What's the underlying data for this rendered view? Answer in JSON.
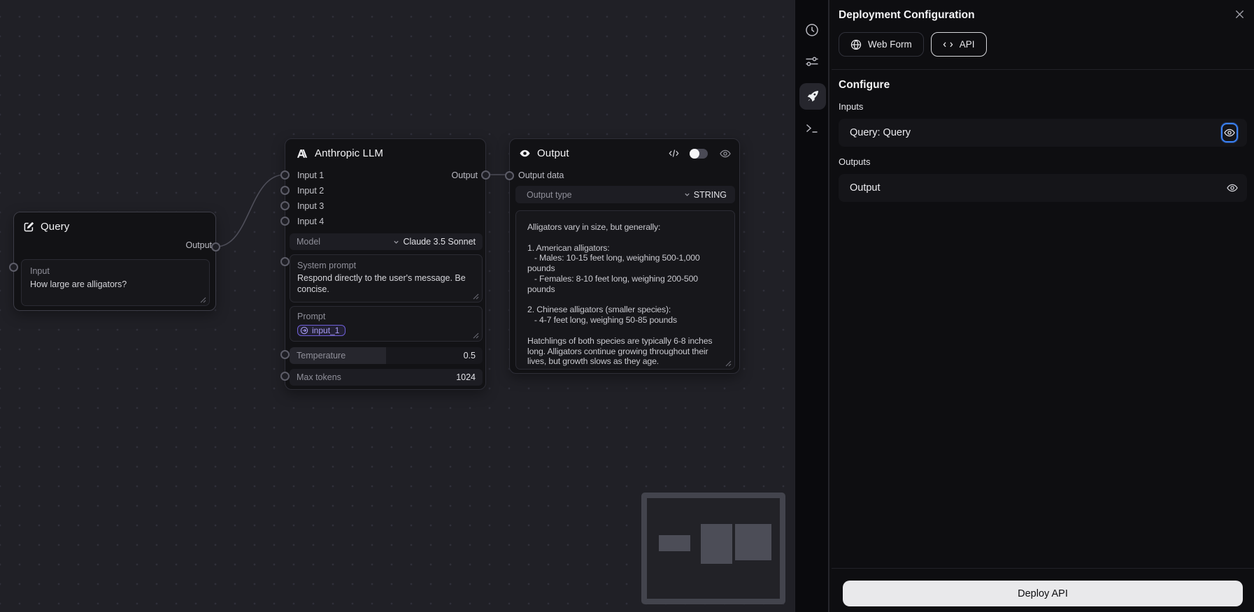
{
  "canvas": {
    "nodes": {
      "query": {
        "title": "Query",
        "output_port_label": "Output",
        "input_field": {
          "label": "Input",
          "value": "How large are alligators?"
        }
      },
      "llm": {
        "title": "Anthropic LLM",
        "input_ports": [
          "Input 1",
          "Input 2",
          "Input 3",
          "Input 4"
        ],
        "output_port_label": "Output",
        "model": {
          "label": "Model",
          "value": "Claude 3.5 Sonnet"
        },
        "system_prompt": {
          "label": "System prompt",
          "value": "Respond directly to the user's message. Be\nconcise."
        },
        "prompt": {
          "label": "Prompt",
          "chip": "input_1"
        },
        "temperature": {
          "label": "Temperature",
          "value": "0.5"
        },
        "max_tokens": {
          "label": "Max tokens",
          "value": "1024"
        }
      },
      "output": {
        "title": "Output",
        "data_port_label": "Output data",
        "output_type": {
          "label": "Output type",
          "value": "STRING"
        },
        "result_text": "Alligators vary in size, but generally:\n\n1. American alligators:\n   - Males: 10-15 feet long, weighing 500-1,000 pounds\n   - Females: 8-10 feet long, weighing 200-500 pounds\n\n2. Chinese alligators (smaller species):\n   - 4-7 feet long, weighing 50-85 pounds\n\nHatchlings of both species are typically 6-8 inches\nlong. Alligators continue growing throughout their\nlives, but growth slows as they age."
      }
    }
  },
  "sidebar": {
    "icons": [
      {
        "name": "history-clock-icon",
        "active": false
      },
      {
        "name": "settings-sliders-icon",
        "active": false
      },
      {
        "name": "deploy-rocket-icon",
        "active": true
      },
      {
        "name": "terminal-icon",
        "active": false
      }
    ]
  },
  "panel": {
    "title": "Deployment Configuration",
    "close_icon": "close-x",
    "tabs": [
      {
        "label": "Web Form",
        "icon": "globe-icon",
        "selected": false
      },
      {
        "label": "API",
        "icon": "code-icon",
        "selected": true
      }
    ],
    "configure_heading": "Configure",
    "inputs_heading": "Inputs",
    "input_rows": [
      {
        "label": "Query: Query",
        "eye_focused": true
      }
    ],
    "outputs_heading": "Outputs",
    "output_rows": [
      {
        "label": "Output",
        "eye_focused": false
      }
    ],
    "deploy_button_label": "Deploy API"
  },
  "colors": {
    "focus_ring_blue": "#3b82f6",
    "chip_purple": "#6f5fd8",
    "deploy_button_bg": "#e9e9eb",
    "canvas_bg": "#202026",
    "panel_bg": "#0e0e11"
  }
}
